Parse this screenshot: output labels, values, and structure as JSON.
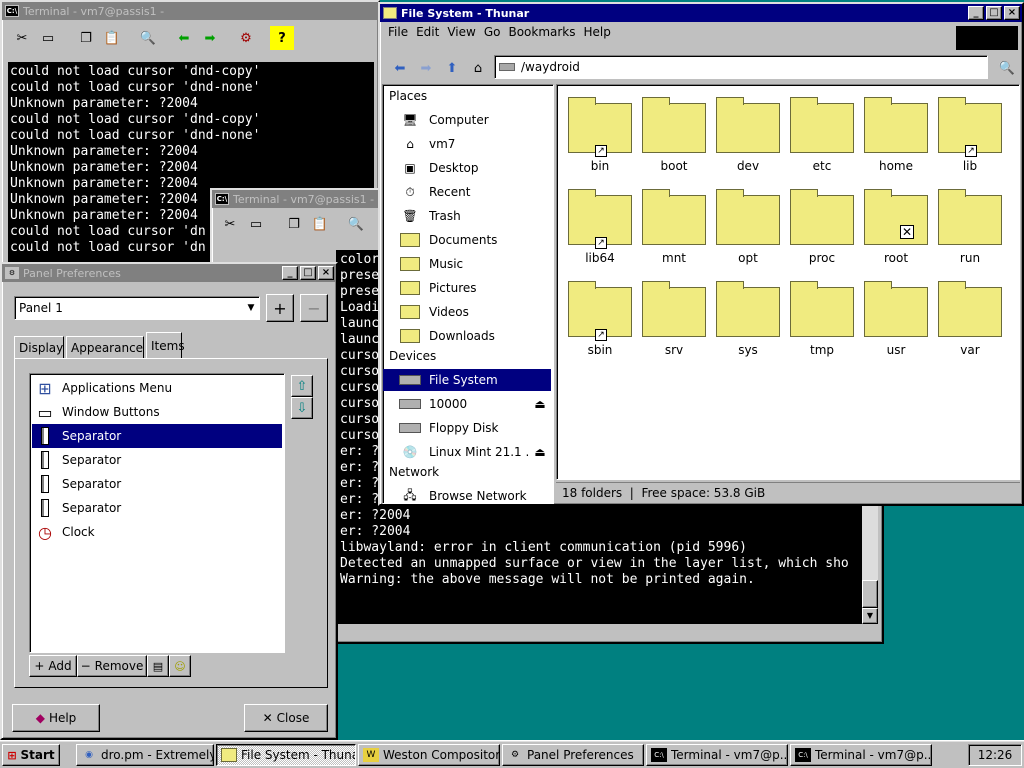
{
  "term1": {
    "title": "Terminal - vm7@passis1 - ",
    "lines": [
      "could not load cursor 'dnd-copy'",
      "could not load cursor 'dnd-none'",
      "Unknown parameter: ?2004",
      "could not load cursor 'dnd-copy'",
      "could not load cursor 'dnd-none'",
      "Unknown parameter: ?2004",
      "Unknown parameter: ?2004",
      "Unknown parameter: ?2004",
      "Unknown parameter: ?2004",
      "Unknown parameter: ?2004",
      "could not load cursor 'dn",
      "could not load cursor 'dn"
    ]
  },
  "term2": {
    "title": "Terminal - vm7@passis1 - ",
    "lines": [
      "color",
      "prese",
      "prese",
      "Loadi",
      "launc",
      "launc",
      "curso",
      "curso",
      "curso",
      "curso",
      "curso",
      "curso",
      "er: ?",
      "er: ?",
      "er: ?",
      "er: ?2004",
      "er: ?2004",
      "er: ?2004",
      "libwayland: error in client communication (pid 5996)",
      "Detected an unmapped surface or view in the layer list, which sho",
      "",
      "Warning: the above message will not be printed again."
    ]
  },
  "thunar": {
    "title": "File System - Thunar",
    "menu": [
      "File",
      "Edit",
      "View",
      "Go",
      "Bookmarks",
      "Help"
    ],
    "path": "/waydroid",
    "places_header": "Places",
    "devices_header": "Devices",
    "network_header": "Network",
    "places": [
      "Computer",
      "vm7",
      "Desktop",
      "Recent",
      "Trash",
      "Documents",
      "Music",
      "Pictures",
      "Videos",
      "Downloads"
    ],
    "devices": [
      "File System",
      "10000",
      "Floppy Disk",
      "Linux Mint 21.1 ..."
    ],
    "network": [
      "Browse Network"
    ],
    "folders": [
      "bin",
      "boot",
      "dev",
      "etc",
      "home",
      "lib",
      "lib64",
      "mnt",
      "opt",
      "proc",
      "root",
      "run",
      "sbin",
      "srv",
      "sys",
      "tmp",
      "usr",
      "var"
    ],
    "status": "18 folders  |  Free space: 53.8 GiB"
  },
  "panelprefs": {
    "title": "Panel Preferences",
    "panel_select": "Panel 1",
    "tabs": [
      "Display",
      "Appearance",
      "Items"
    ],
    "items": [
      "Applications Menu",
      "Window Buttons",
      "Separator",
      "Separator",
      "Separator",
      "Separator",
      "Clock"
    ],
    "add_label": "Add",
    "remove_label": "Remove",
    "help_label": "Help",
    "close_label": "Close"
  },
  "taskbar": {
    "start_label": "Start",
    "tasks": [
      "dro.pm - Extremely ...",
      "File System - Thunar",
      "Weston Compositor...",
      "Panel Preferences",
      "Terminal - vm7@p...",
      "Terminal - vm7@p..."
    ],
    "clock": "12:26"
  }
}
